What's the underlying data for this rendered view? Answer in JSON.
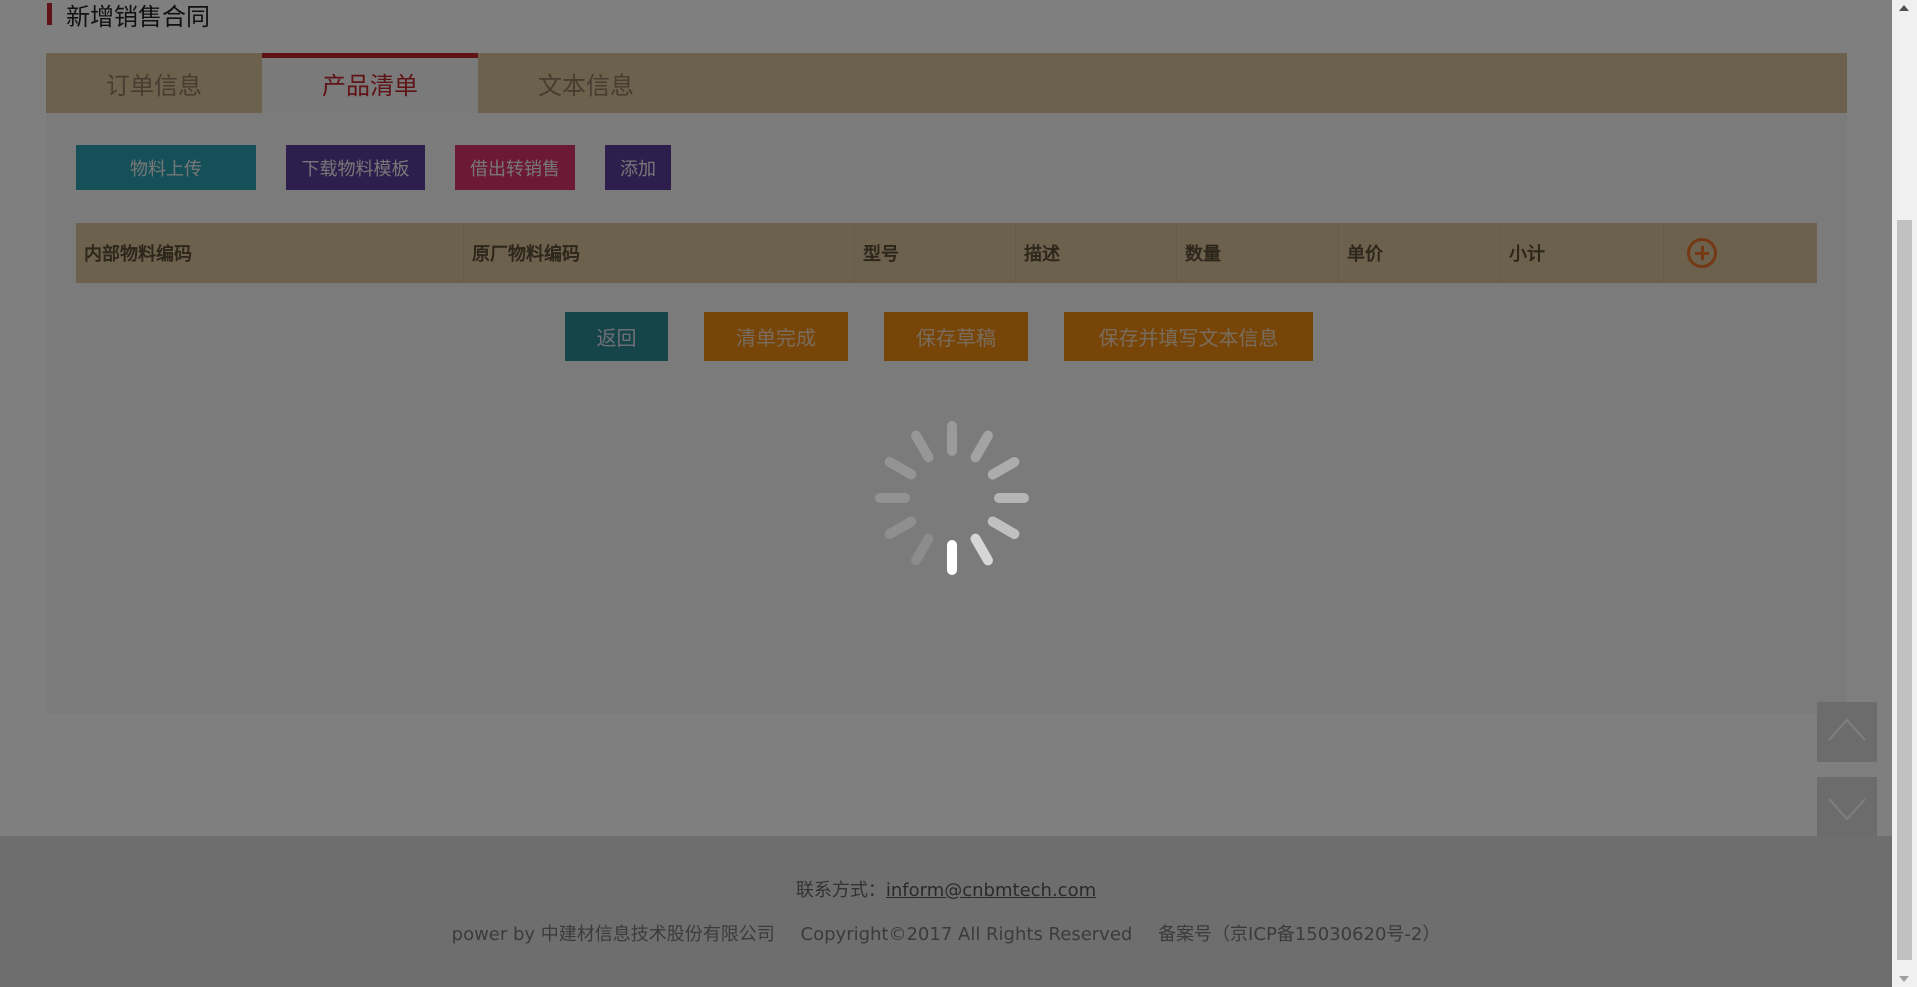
{
  "page": {
    "title": "新增销售合同"
  },
  "tabs": [
    {
      "label": "订单信息",
      "active": false
    },
    {
      "label": "产品清单",
      "active": true
    },
    {
      "label": "文本信息",
      "active": false
    }
  ],
  "toolbar": {
    "upload_label": "物料上传",
    "download_template_label": "下载物料模板",
    "borrow_to_sale_label": "借出转销售",
    "add_label": "添加"
  },
  "table": {
    "columns": [
      "内部物料编码",
      "原厂物料编码",
      "型号",
      "描述",
      "数量",
      "单价",
      "小计"
    ],
    "add_icon": "plus-circle-icon"
  },
  "actions": {
    "back_label": "返回",
    "complete_label": "清单完成",
    "save_draft_label": "保存草稿",
    "save_and_fill_label": "保存并填写文本信息"
  },
  "footer": {
    "contact_prefix": "联系方式：",
    "contact_email": "inform@cnbmtech.com",
    "powered_by": "power by 中建材信息技术股份有限公司",
    "copyright": "Copyright©2017 All Rights Reserved",
    "icp": "备案号（京ICP备15030620号-2）"
  },
  "colors": {
    "accent_red": "#c0272d",
    "tab_bar": "#d8c39a",
    "teal": "#2aa0b0",
    "purple": "#5d3d9a",
    "pink": "#d9336a",
    "orange": "#f08a13",
    "overlay": "rgba(0,0,0,0.5)"
  },
  "loading": {
    "visible": true,
    "icon": "loading-spinner-icon"
  }
}
